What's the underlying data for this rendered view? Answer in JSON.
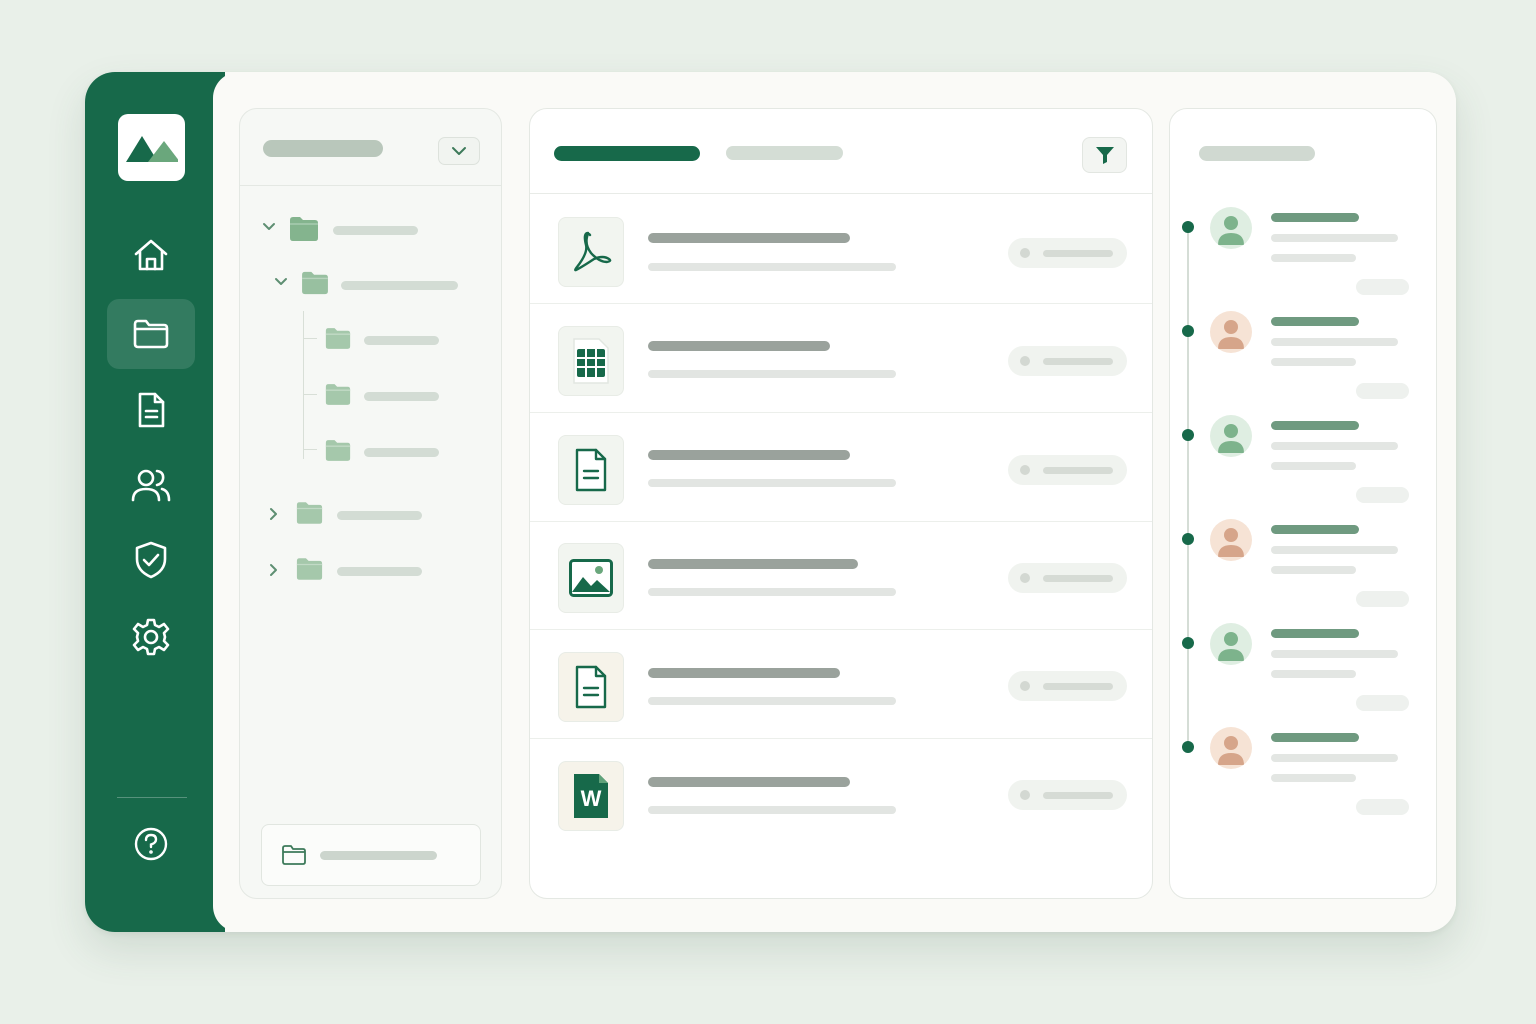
{
  "colors": {
    "brand": "#17694a",
    "background": "#e9f0e9",
    "surface": "#ffffff",
    "folder": "#84b48e",
    "avatar_green": "#dfeee2",
    "avatar_peach": "#f6e3d5"
  },
  "sidebar": {
    "logo": "mountains-logo",
    "items": [
      {
        "icon": "home-icon",
        "active": false
      },
      {
        "icon": "folder-icon",
        "active": true
      },
      {
        "icon": "document-icon",
        "active": false
      },
      {
        "icon": "users-icon",
        "active": false
      },
      {
        "icon": "shield-check-icon",
        "active": false
      },
      {
        "icon": "gear-icon",
        "active": false
      }
    ],
    "footer_icon": "help-circle-icon"
  },
  "folder_tree": {
    "header_icon": "chevron-down-icon",
    "nodes": [
      {
        "depth": 0,
        "expanded": true,
        "icon": "folder-icon"
      },
      {
        "depth": 1,
        "expanded": true,
        "icon": "folder-icon"
      },
      {
        "depth": 2,
        "icon": "folder-icon"
      },
      {
        "depth": 2,
        "icon": "folder-icon"
      },
      {
        "depth": 2,
        "icon": "folder-icon"
      },
      {
        "depth": 0,
        "expanded": false,
        "icon": "folder-icon"
      },
      {
        "depth": 0,
        "expanded": false,
        "icon": "folder-icon"
      }
    ],
    "new_folder_icon": "folder-outline-icon"
  },
  "file_list": {
    "active_tab": 0,
    "filter_icon": "filter-icon",
    "files": [
      {
        "type": "pdf",
        "icon": "pdf-icon"
      },
      {
        "type": "spreadsheet",
        "icon": "spreadsheet-icon"
      },
      {
        "type": "document",
        "icon": "document-icon"
      },
      {
        "type": "image",
        "icon": "image-icon"
      },
      {
        "type": "document",
        "icon": "document-icon"
      },
      {
        "type": "word",
        "icon": "word-icon",
        "glyph": "W"
      }
    ]
  },
  "activity": {
    "items": [
      {
        "avatar": "user-avatar-icon",
        "tone": "green"
      },
      {
        "avatar": "user-avatar-icon",
        "tone": "peach"
      },
      {
        "avatar": "user-avatar-icon",
        "tone": "green"
      },
      {
        "avatar": "user-avatar-icon",
        "tone": "peach"
      },
      {
        "avatar": "user-avatar-icon",
        "tone": "green"
      },
      {
        "avatar": "user-avatar-icon",
        "tone": "peach"
      }
    ]
  }
}
